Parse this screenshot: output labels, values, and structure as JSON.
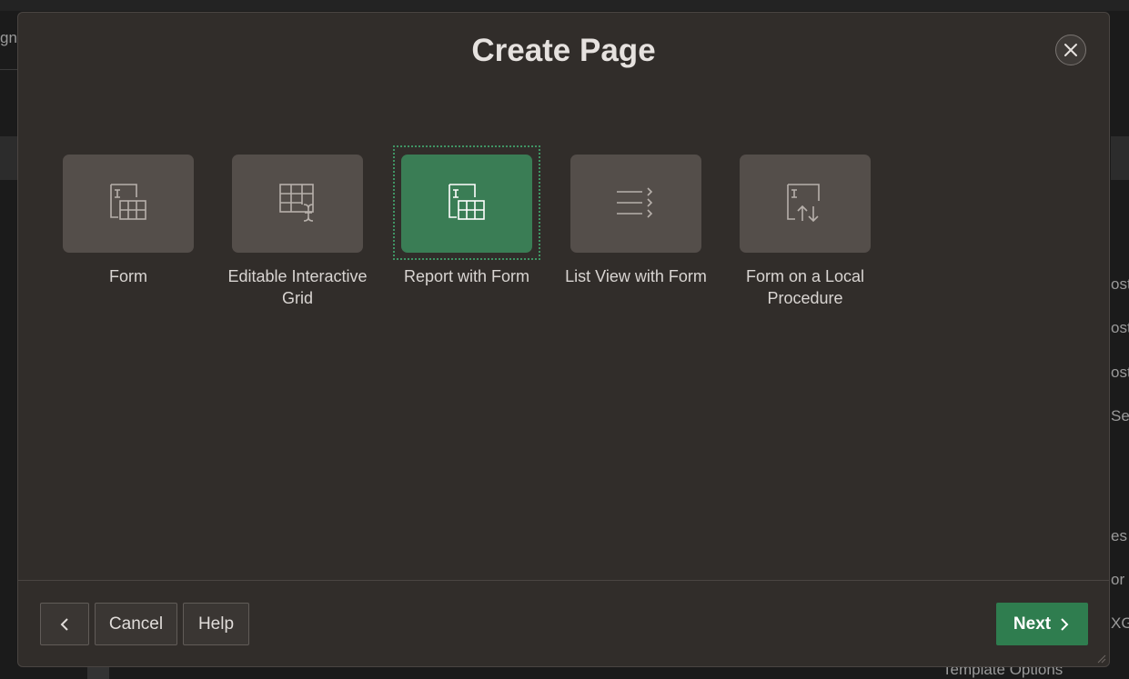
{
  "dialog": {
    "title": "Create Page",
    "close_label": "Close"
  },
  "tiles": [
    {
      "label": "Form",
      "icon": "form-icon",
      "selected": false
    },
    {
      "label": "Editable Interactive Grid",
      "icon": "editable-grid-icon",
      "selected": false
    },
    {
      "label": "Report with Form",
      "icon": "report-with-form-icon",
      "selected": true
    },
    {
      "label": "List View with Form",
      "icon": "list-view-icon",
      "selected": false
    },
    {
      "label": "Form on a Local Procedure",
      "icon": "form-procedure-icon",
      "selected": false
    }
  ],
  "footer": {
    "back_label": "‹",
    "cancel_label": "Cancel",
    "help_label": "Help",
    "next_label": "Next"
  },
  "background": {
    "left_fragment": "gne",
    "right_fragments": [
      "ost",
      "ost",
      "ost",
      "Se",
      "es",
      "or",
      "XG"
    ],
    "bottom_fragment": "Template Options"
  },
  "colors": {
    "accent": "#3a7d55",
    "next_button": "#2f7d4f",
    "dialog_bg": "#312d2a",
    "tile_bg": "#544e4a"
  }
}
